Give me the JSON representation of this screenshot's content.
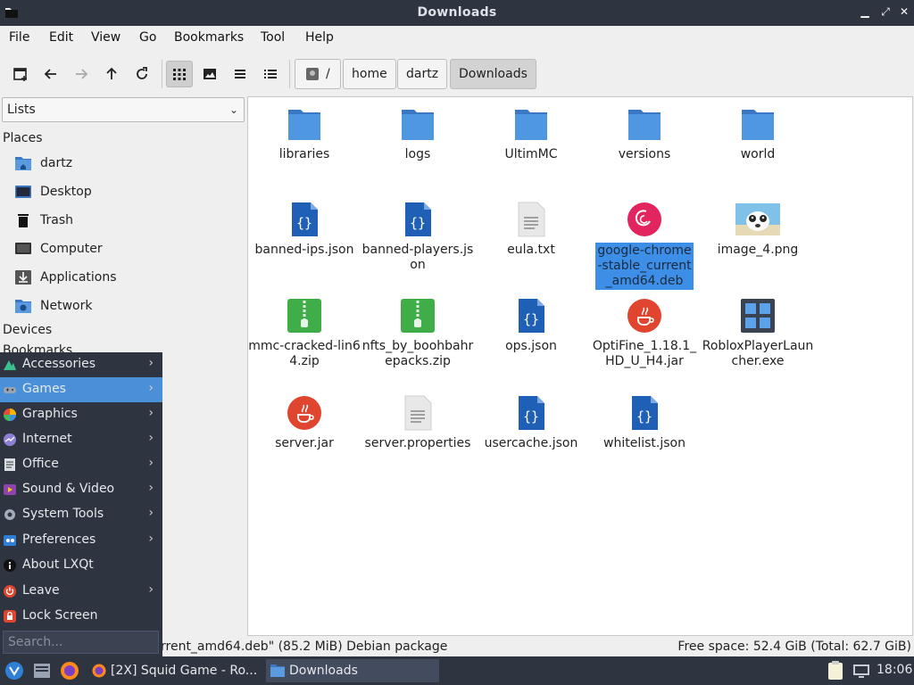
{
  "window": {
    "title": "Downloads"
  },
  "menubar": {
    "items": [
      "File",
      "Edit",
      "View",
      "Go",
      "Bookmarks",
      "Tool",
      "Help"
    ]
  },
  "breadcrumb": {
    "root": "/",
    "parts": [
      "home",
      "dartz",
      "Downloads"
    ]
  },
  "sidebar": {
    "selector_value": "Lists",
    "places_heading": "Places",
    "places": [
      "dartz",
      "Desktop",
      "Trash",
      "Computer",
      "Applications",
      "Network"
    ],
    "devices_heading": "Devices",
    "bookmarks_heading": "Bookmarks"
  },
  "files": [
    {
      "name": "libraries",
      "icon": "folder-icon"
    },
    {
      "name": "logs",
      "icon": "folder-icon"
    },
    {
      "name": "UltimMC",
      "icon": "folder-icon"
    },
    {
      "name": "versions",
      "icon": "folder-icon"
    },
    {
      "name": "world",
      "icon": "folder-icon"
    },
    {
      "name": "banned-ips.json",
      "icon": "json-file-icon"
    },
    {
      "name": "banned-players.json",
      "icon": "json-file-icon"
    },
    {
      "name": "eula.txt",
      "icon": "text-file-icon"
    },
    {
      "name": "google-chrome-stable_current_amd64.deb",
      "icon": "debian-package-icon",
      "selected": true
    },
    {
      "name": "image_4.png",
      "icon": "image-thumbnail-icon"
    },
    {
      "name": "mmc-cracked-lin64.zip",
      "icon": "zip-archive-icon"
    },
    {
      "name": "nfts_by_boohbahrepacks.zip",
      "icon": "zip-archive-icon"
    },
    {
      "name": "ops.json",
      "icon": "json-file-icon"
    },
    {
      "name": "OptiFine_1.18.1_HD_U_H4.jar",
      "icon": "java-jar-icon"
    },
    {
      "name": "RobloxPlayerLauncher.exe",
      "icon": "exe-file-icon"
    },
    {
      "name": "server.jar",
      "icon": "java-jar-icon"
    },
    {
      "name": "server.properties",
      "icon": "text-file-icon"
    },
    {
      "name": "usercache.json",
      "icon": "json-file-icon"
    },
    {
      "name": "whitelist.json",
      "icon": "json-file-icon"
    }
  ],
  "statusbar": {
    "left": "rrent_amd64.deb\" (85.2 MiB) Debian package",
    "right": "Free space: 52.4 GiB (Total: 62.7 GiB)"
  },
  "start_menu": {
    "items": [
      {
        "label": "Accessories",
        "submenu": true
      },
      {
        "label": "Games",
        "submenu": true,
        "highlighted": true
      },
      {
        "label": "Graphics",
        "submenu": true
      },
      {
        "label": "Internet",
        "submenu": true
      },
      {
        "label": "Office",
        "submenu": true
      },
      {
        "label": "Sound & Video",
        "submenu": true
      },
      {
        "label": "System Tools",
        "submenu": true
      },
      {
        "label": "Preferences",
        "submenu": true
      },
      {
        "label": "About LXQt",
        "submenu": false
      },
      {
        "label": "Leave",
        "submenu": true
      },
      {
        "label": "Lock Screen",
        "submenu": false
      }
    ],
    "search_placeholder": "Search..."
  },
  "taskbar": {
    "tasks": [
      {
        "label": "[2X] Squid Game - Ro...",
        "icon": "firefox-icon"
      },
      {
        "label": "Downloads",
        "icon": "folder-icon",
        "active": true
      }
    ],
    "clock": "18:06"
  },
  "colors": {
    "accent": "#3d8ee6",
    "panel": "#2e3440",
    "folder": "#4a90d9"
  }
}
